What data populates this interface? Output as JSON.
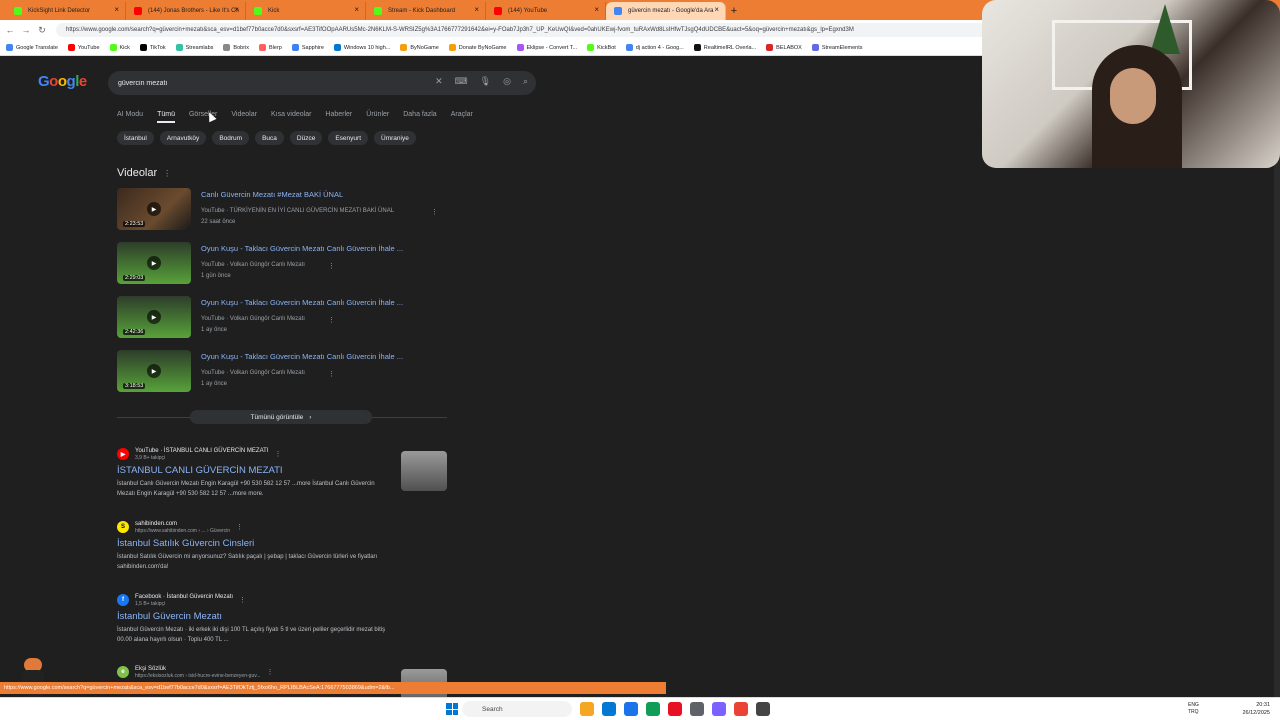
{
  "browser": {
    "tabs": [
      {
        "title": "KickSight Link Detector",
        "color": "#53fc18"
      },
      {
        "title": "(144) Jonas Brothers - Like It's Ch",
        "color": "#ff0000"
      },
      {
        "title": "Kick",
        "color": "#53fc18"
      },
      {
        "title": "Stream - Kick Dashboard",
        "color": "#53fc18"
      },
      {
        "title": "(144) YouTube",
        "color": "#ff0000"
      },
      {
        "title": "güvercin mezatı - Google'da Ara",
        "color": "#4285f4",
        "active": true
      }
    ],
    "new_tab": "+",
    "url": "https://www.google.com/search?q=güvercin+mezatı&sca_esv=d1bef77b0acce7d0&sxsrf=AE3TifOOpAARUs5Mc-2N6KLM-S-WRSIZ5g%3A1766777291642&ei=y-FOab7Jp3h7_UP_KeUwQI&ved=0ahUKEwj-fvom_tuRAxWd8LsIHfwTJsgQ4dUDCBE&uact=5&oq=güvercin+mezatı&gs_lp=Egxnd3M",
    "bookmarks": [
      {
        "label": "Google Translate",
        "color": "#4285f4"
      },
      {
        "label": "YouTube",
        "color": "#ff0000"
      },
      {
        "label": "Kick",
        "color": "#53fc18"
      },
      {
        "label": "TikTok",
        "color": "#000000"
      },
      {
        "label": "Streamlabs",
        "color": "#31c3a2"
      },
      {
        "label": "Bobrix",
        "color": "#888888"
      },
      {
        "label": "Blerp",
        "color": "#ff5f5f"
      },
      {
        "label": "Sapphire",
        "color": "#3b82f6"
      },
      {
        "label": "Windows 10 high...",
        "color": "#0078d4"
      },
      {
        "label": "ByNoGame",
        "color": "#f59e0b"
      },
      {
        "label": "Donate ByNoGame",
        "color": "#f59e0b"
      },
      {
        "label": "Eklipse - Convert T...",
        "color": "#a855f7"
      },
      {
        "label": "KickBot",
        "color": "#53fc18"
      },
      {
        "label": "dj action 4 - Goog...",
        "color": "#4285f4"
      },
      {
        "label": "RealtimeIRL Overla...",
        "color": "#111111"
      },
      {
        "label": "BELABOX",
        "color": "#dc2626"
      },
      {
        "label": "StreamElements",
        "color": "#6366f1"
      }
    ]
  },
  "google": {
    "logo": [
      "G",
      "o",
      "o",
      "g",
      "l",
      "e"
    ],
    "query": "güvercin mezatı",
    "nav_tabs": [
      "AI Modu",
      "Tümü",
      "Görseller",
      "Videolar",
      "Kısa videolar",
      "Haberler",
      "Ürünler",
      "Daha fazla",
      "Araçlar"
    ],
    "chips": [
      "İstanbul",
      "Arnavutköy",
      "Bodrum",
      "Buca",
      "Düzce",
      "Esenyurt",
      "Ümraniye"
    ],
    "videos_heading": "Videolar",
    "videos": [
      {
        "title": "Canlı Güvercin Mezatı #Mezat BAKİ ÜNAL",
        "meta": "YouTube · TÜRKİYENİN EN İYİ CANLI GÜVERCİN MEZATI BAKİ ÜNAL",
        "date": "22 saat önce",
        "duration": "2:23:53"
      },
      {
        "title": "Oyun Kuşu - Taklacı Güvercin Mezatı Canlı Güvercin İhale ...",
        "meta": "YouTube · Volkan Güngör Canlı Mezatı",
        "date": "1 gün önce",
        "duration": "2:29:03"
      },
      {
        "title": "Oyun Kuşu - Taklacı Güvercin Mezatı Canlı Güvercin İhale ...",
        "meta": "YouTube · Volkan Güngör Canlı Mezatı",
        "date": "1 ay önce",
        "duration": "2:42:36"
      },
      {
        "title": "Oyun Kuşu - Taklacı Güvercin Mezatı Canlı Güvercin İhale ...",
        "meta": "YouTube · Volkan Güngör Canlı Mezatı",
        "date": "1 ay önce",
        "duration": "3:18:53"
      }
    ],
    "see_all": "Tümünü görüntüle",
    "results": [
      {
        "source": "YouTube · İSTANBUL CANLI GÜVERCİN MEZATI",
        "sub": "3,9 B+ takipçi",
        "fav": "▶",
        "fav_bg": "#ff0000",
        "fav_fg": "#ffffff",
        "title": "İSTANBUL CANLI GÜVERCİN MEZATI",
        "snippet": "İstanbul Canlı Güvercin Mezatı Engin Karagül +90 530 582 12 57 ...more İstanbul Canlı Güvercin Mezatı Engin Karagül +90 530 582 12 57 ...more more."
      },
      {
        "source": "sahibinden.com",
        "sub": "https://www.sahibinden.com › ... › Güvercin",
        "fav": "S",
        "fav_bg": "#ffe800",
        "fav_fg": "#000000",
        "title": "İstanbul Satılık Güvercin Cinsleri",
        "snippet": "İstanbul Satılık Güvercin mi arıyorsunuz? Satılık paçalı | şebap | taklacı Güvercin türleri ve fiyatları sahibinden.com'da!"
      },
      {
        "source": "Facebook · İstanbul Güvercin Mezatı",
        "sub": "1,5 B+ takipçi",
        "fav": "f",
        "fav_bg": "#1877f2",
        "fav_fg": "#ffffff",
        "title": "İstanbul Güvercin Mezatı",
        "snippet": "İstanbul Güvercin Mezatı · iki erkek iki dişi 100 TL açılış fiyatı 5 tl ve üzeri peliler geçerlidir mezat bitiş 00.00 alana hayırlı olsun · Toplu 400 TL ..."
      },
      {
        "source": "Ekşi Sözlük",
        "sub": "https://eksisozluk.com › isid-hucre-evine-benzeyen-guv...",
        "fav": "e",
        "fav_bg": "#81c14b",
        "fav_fg": "#ffffff",
        "title": "",
        "snippet": ""
      }
    ]
  },
  "status_url": "https://www.google.com/search?q=güvercin+mezatı&sca_esv=d1bef77b0acce7d0&sxsrf=AE3TifOkTztj_5fxo6ho_RPLIBLBAcSeA:1766777503869&udm=2&fb...",
  "taskbar": {
    "search_placeholder": "Search",
    "lang_top": "ENG",
    "lang_bottom": "TRQ",
    "time": "20:31",
    "date": "26/12/2025",
    "apps": [
      "#f5a623",
      "#0078d4",
      "#1a73e8",
      "#0f9d58",
      "#e81123",
      "#5f6368",
      "#7b61ff",
      "#ea4335",
      "#444444"
    ]
  }
}
